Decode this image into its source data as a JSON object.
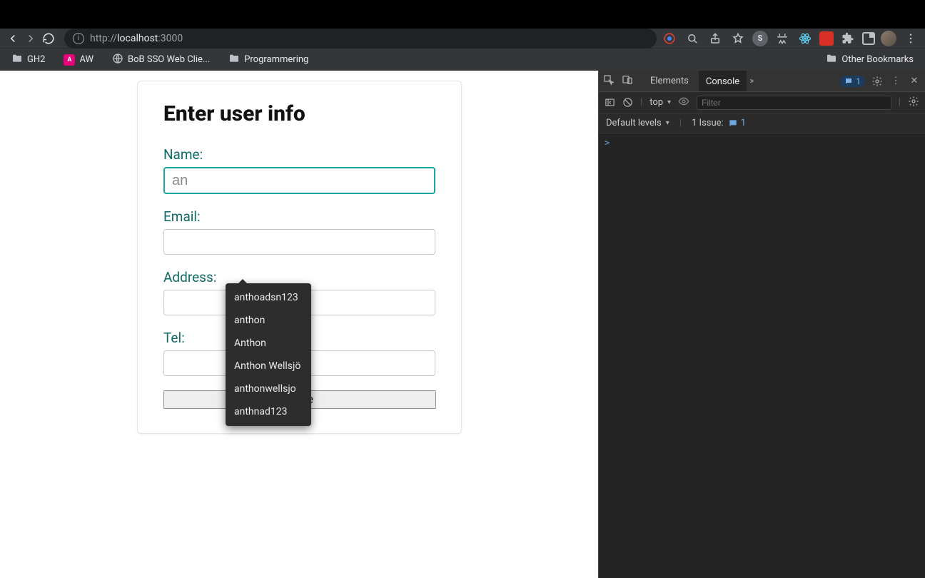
{
  "browser": {
    "url_protocol": "http://",
    "url_host": "localhost",
    "url_port": ":3000"
  },
  "bookmarks": {
    "items": [
      {
        "label": "GH2",
        "kind": "folder"
      },
      {
        "label": "AW",
        "kind": "aw"
      },
      {
        "label": "BoB SSO Web Clie...",
        "kind": "globe"
      },
      {
        "label": "Programmering",
        "kind": "folder"
      }
    ],
    "other_label": "Other Bookmarks"
  },
  "form": {
    "title": "Enter user info",
    "name_label": "Name:",
    "name_value": "an",
    "email_label": "Email:",
    "email_value": "",
    "address_label": "Address:",
    "address_value": "",
    "tel_label": "Tel:",
    "tel_value": "",
    "save_label": "Save"
  },
  "autocomplete": {
    "items": [
      "anthoadsn123",
      "anthon",
      "Anthon",
      "Anthon Wellsjö",
      "anthonwellsjo",
      "anthnad123"
    ]
  },
  "devtools": {
    "tabs": {
      "elements": "Elements",
      "console": "Console"
    },
    "message_count": "1",
    "context": "top",
    "filter_placeholder": "Filter",
    "levels_label": "Default levels",
    "issues_label": "1 Issue:",
    "issues_count": "1",
    "prompt": ">"
  }
}
